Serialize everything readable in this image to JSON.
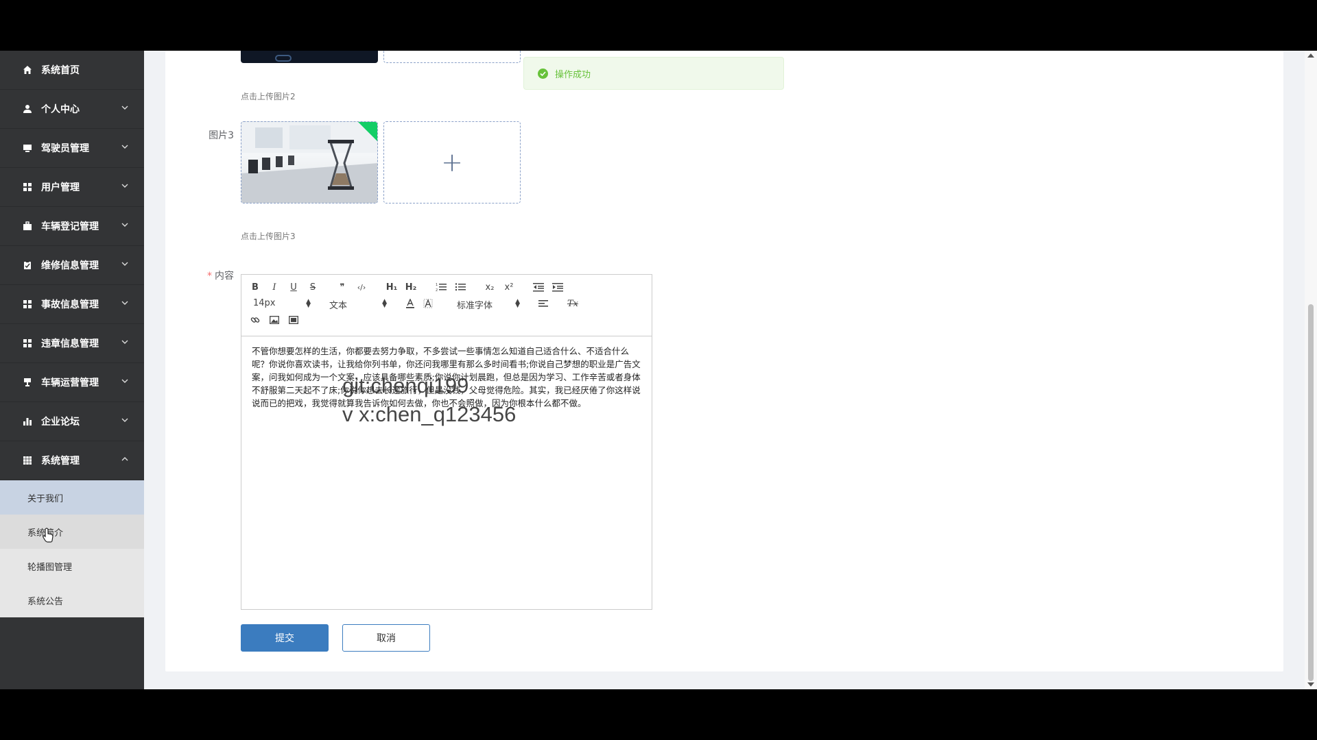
{
  "sidebar": {
    "items": [
      {
        "label": "系统首页",
        "icon": "home-icon"
      },
      {
        "label": "个人中心",
        "icon": "user-icon"
      },
      {
        "label": "驾驶员管理",
        "icon": "monitor-icon"
      },
      {
        "label": "用户管理",
        "icon": "grid-icon"
      },
      {
        "label": "车辆登记管理",
        "icon": "briefcase-icon"
      },
      {
        "label": "维修信息管理",
        "icon": "clipboard-icon"
      },
      {
        "label": "事故信息管理",
        "icon": "grid-icon"
      },
      {
        "label": "违章信息管理",
        "icon": "grid-icon"
      },
      {
        "label": "车辆运营管理",
        "icon": "trophy-icon"
      },
      {
        "label": "企业论坛",
        "icon": "bar-chart-icon"
      },
      {
        "label": "系统管理",
        "icon": "grid-icon"
      }
    ],
    "submenu": [
      "关于我们",
      "系统简介",
      "轮播图管理",
      "系统公告"
    ]
  },
  "form": {
    "hint2": "点击上传图片2",
    "label3": "图片3",
    "hint3": "点击上传图片3",
    "content_label": "内容",
    "content_required_mark": "*",
    "plus": "+"
  },
  "editor": {
    "toolbar": {
      "bold": "B",
      "italic": "I",
      "underline": "U",
      "strike": "S",
      "quote": "❞",
      "code": "‹/›",
      "h1": "H₁",
      "h2": "H₂",
      "subscript": "x₂",
      "superscript": "x²",
      "font_size": "14px",
      "header_select": "文本",
      "font_family": "标准字体",
      "clean": "Tx"
    },
    "body": "不管你想要怎样的生活，你都要去努力争取，不多尝试一些事情怎么知道自己适合什么、不适合什么呢？你说你喜欢读书，让我给你列书单，你还问我哪里有那么多时间看书;你说自己梦想的职业是广告文案，问我如何成为一个文案，应该具备哪些素质;你说你计划晨跑，但总是因为学习、工作辛苦或者身体不舒服第二天起不了床;你说你想去长途旅行，但是没钱，父母觉得危险。其实，我已经厌倦了你这样说说而已的把戏，我觉得就算我告诉你如何去做，你也不会照做，因为你根本什么都不做。",
    "watermark1": "git:chenqi199",
    "watermark2": "v x:chen_q123456"
  },
  "buttons": {
    "submit": "提交",
    "cancel": "取消"
  },
  "toast": {
    "text": "操作成功"
  },
  "colors": {
    "sidebar": "#333436",
    "primary": "#3b7cbf",
    "success": "#67c23a"
  }
}
